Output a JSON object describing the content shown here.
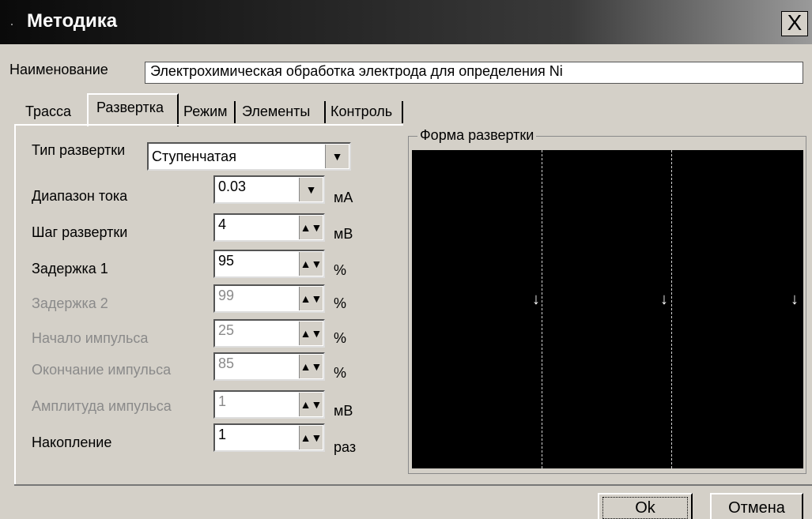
{
  "window": {
    "title": "Методика",
    "close_label": "X"
  },
  "name_field": {
    "label": "Наименование",
    "value": "Электрохимическая обработка электрода для определения Ni"
  },
  "tabs": [
    {
      "label": "Трасса"
    },
    {
      "label": "Развертка",
      "active": true
    },
    {
      "label": "Режим"
    },
    {
      "label": "Элементы"
    },
    {
      "label": "Контроль"
    }
  ],
  "sweep": {
    "type_label": "Тип развертки",
    "type_value": "Ступенчатая",
    "fields": [
      {
        "label": "Диапазон тока",
        "value": "0.03",
        "unit": "мА",
        "enabled": true
      },
      {
        "label": "Шаг развертки",
        "value": "4",
        "unit": "мВ",
        "enabled": true
      },
      {
        "label": "Задержка 1",
        "value": "95",
        "unit": "%",
        "enabled": true
      },
      {
        "label": "Задержка 2",
        "value": "99",
        "unit": "%",
        "enabled": false
      },
      {
        "label": "Начало импульса",
        "value": "25",
        "unit": "%",
        "enabled": false
      },
      {
        "label": "Окончание импульса",
        "value": "85",
        "unit": "%",
        "enabled": false
      },
      {
        "label": "Амплитуда импульса",
        "value": "1",
        "unit": "мВ",
        "enabled": false
      },
      {
        "label": "Накопление",
        "value": "1",
        "unit": "раз",
        "enabled": true
      }
    ]
  },
  "preview": {
    "title": "Форма развертки",
    "arrow": "↓"
  },
  "buttons": {
    "ok": "Ok",
    "cancel": "Отмена"
  },
  "icons": {
    "combo": "▼",
    "spin": "▲▼"
  },
  "colors": {
    "window_bg": "#d4d0c8",
    "plot_bg": "#000000",
    "disabled_text": "#8a8a8a"
  }
}
